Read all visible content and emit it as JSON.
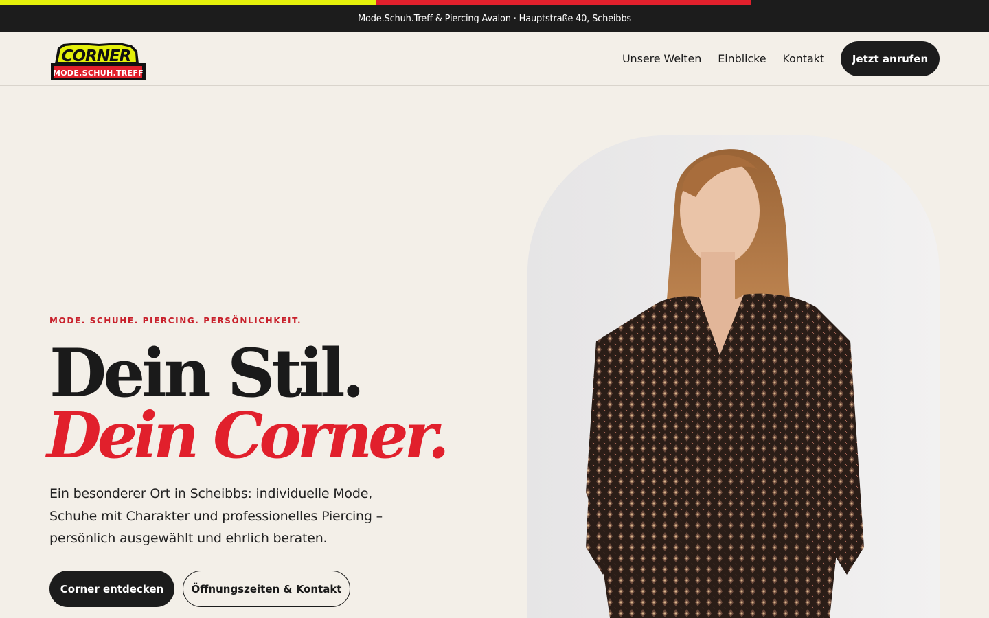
{
  "announcement": {
    "text": "Mode.Schuh.Treff & Piercing Avalon · Hauptstraße 40, Scheibbs"
  },
  "brand": {
    "logo_top_text": "CORNER",
    "logo_bottom_text": "MODE.SCHUH.TREFF",
    "colors": {
      "yellow": "#e4f00b",
      "red": "#e1202c",
      "dark": "#1c1c1c",
      "cream": "#f3efe8"
    }
  },
  "nav": {
    "items": [
      {
        "label": "Unsere Welten"
      },
      {
        "label": "Einblicke"
      },
      {
        "label": "Kontakt"
      }
    ],
    "cta_label": "Jetzt anrufen"
  },
  "hero": {
    "eyebrow": "MODE. SCHUHE. PIERCING. PERSÖNLICHKEIT.",
    "headline_line1": "Dein Stil.",
    "headline_line2": "Dein Corner.",
    "lead": "Ein besonderer Ort in Scheibbs: individuelle Mode, Schuhe mit Charakter und professionelles Piercing – persönlich ausgewählt und ehrlich beraten.",
    "primary_button": "Corner entdecken",
    "secondary_button": "Öffnungszeiten & Kontakt",
    "image_icon": "model-photo"
  }
}
